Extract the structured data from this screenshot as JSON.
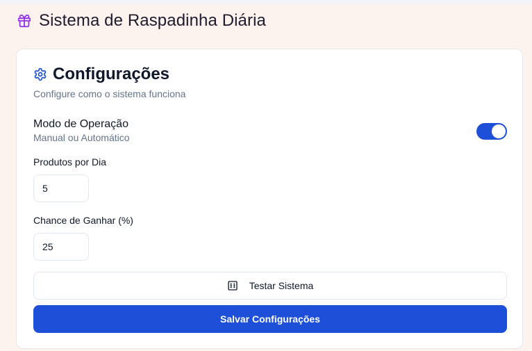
{
  "header": {
    "title": "Sistema de Raspadinha Diária",
    "icon": "gift-icon",
    "icon_color": "#9333ea"
  },
  "card": {
    "title": "Configurações",
    "title_icon": "gear-icon",
    "title_icon_color": "#1d4fd8",
    "subtitle": "Configure como o sistema funciona"
  },
  "mode": {
    "label": "Modo de Operação",
    "description": "Manual ou Automático",
    "enabled": true
  },
  "products_per_day": {
    "label": "Produtos por Dia",
    "value": "5"
  },
  "win_chance": {
    "label": "Chance de Ganhar (%)",
    "value": "25"
  },
  "test_button": {
    "label": "Testar Sistema",
    "icon": "dice-icon"
  },
  "save_button": {
    "label": "Salvar Configurações"
  },
  "colors": {
    "accent": "#1d4fd8",
    "background": "#fdf3ee"
  }
}
